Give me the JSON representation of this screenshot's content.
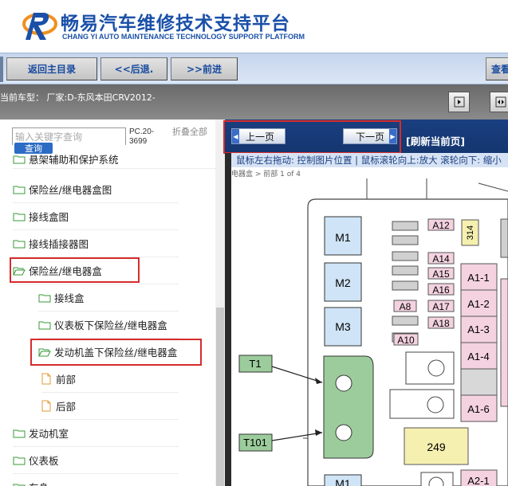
{
  "brand": {
    "title": "畅易汽车维修技术支持平台",
    "subtitle": "CHANG YI AUTO MAINTENANCE TECHNOLOGY SUPPORT PLATFORM"
  },
  "toolbar": {
    "home_label": "返回主目录",
    "back_label": "<<后退.",
    "forward_label": ">>前进",
    "view_label": "查看"
  },
  "model": {
    "text": "当前车型： 厂家:D-东风本田CRV2012-"
  },
  "sidebar": {
    "search_placeholder": "输入关键字查询",
    "search_button": "查询",
    "pc_code": "PC.20-3699",
    "collapse_all": "折叠全部",
    "items": [
      {
        "label": "悬架辅助和保护系统",
        "type": "folder"
      },
      {
        "label": "保险丝/继电器盒图",
        "type": "folder"
      },
      {
        "label": "接线盒图",
        "type": "folder"
      },
      {
        "label": "接线插接器图",
        "type": "folder"
      },
      {
        "label": "保险丝/继电器盒",
        "type": "folder-open"
      },
      {
        "label": "接线盒",
        "type": "folder"
      },
      {
        "label": "仪表板下保险丝/继电器盒",
        "type": "folder"
      },
      {
        "label": "发动机盖下保险丝/继电器盒",
        "type": "folder-open"
      },
      {
        "label": "前部",
        "type": "page"
      },
      {
        "label": "后部",
        "type": "page"
      },
      {
        "label": "发动机室",
        "type": "folder"
      },
      {
        "label": "仪表板",
        "type": "folder"
      },
      {
        "label": "车身",
        "type": "folder"
      }
    ]
  },
  "viewer": {
    "prev_page": "上一页",
    "next_page": "下一页",
    "refresh": "[刷新当前页]",
    "hint": "鼠标左右拖动: 控制图片位置 | 鼠标滚轮向上:放大   滚轮向下: 缩小",
    "breadcrumb": "电器盒 > 前部    1 of 4"
  },
  "diagram": {
    "relays": [
      "M1",
      "M2",
      "M3",
      "M1"
    ],
    "fuses_small": [
      "A12",
      "A14",
      "A15",
      "A16",
      "A17",
      "A18",
      "A8",
      "A10"
    ],
    "fuse_314": "314",
    "fuses_pink": [
      "A1-1",
      "A1-2",
      "A1-3",
      "A1-4",
      "A1-6",
      "A2-1"
    ],
    "connectors": [
      "T1",
      "T101"
    ],
    "block_249": "249"
  },
  "colors": {
    "brand_blue": "#1a50a8",
    "toolbar_bg": "#c5d5ec",
    "viewer_bar": "#1a3f80",
    "highlight_red": "#d62c2c",
    "relay_blue": "#cfe4f6",
    "fuse_pink": "#f4d2e0",
    "connector_green": "#9ccc9c",
    "block_yellow": "#f6f0b0"
  }
}
